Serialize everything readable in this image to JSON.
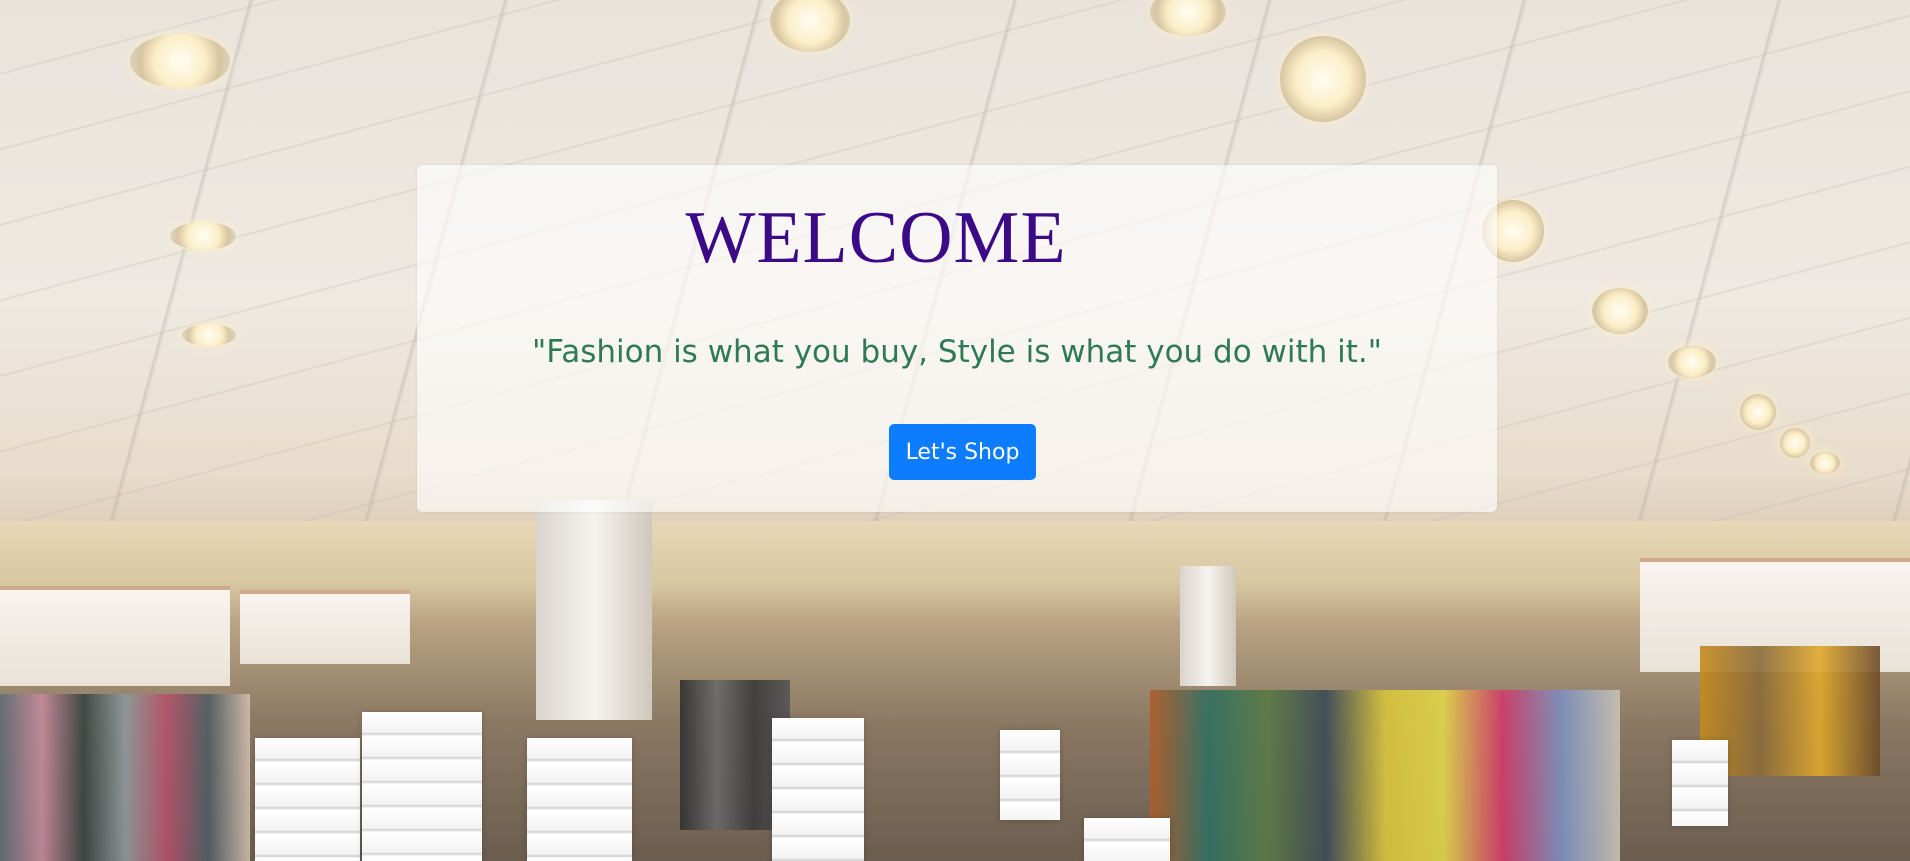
{
  "hero": {
    "background_image": "clothing-store-interior",
    "heading": "WELCOME",
    "tagline": "\"Fashion is what you buy, Style is what you do with it.\"",
    "cta_label": "Let's Shop"
  },
  "colors": {
    "heading": "#3b0a87",
    "tagline": "#2f7a55",
    "cta_background": "#0d7cff",
    "cta_text": "#ffffff",
    "card_background": "rgba(255,255,255,0.62)"
  }
}
